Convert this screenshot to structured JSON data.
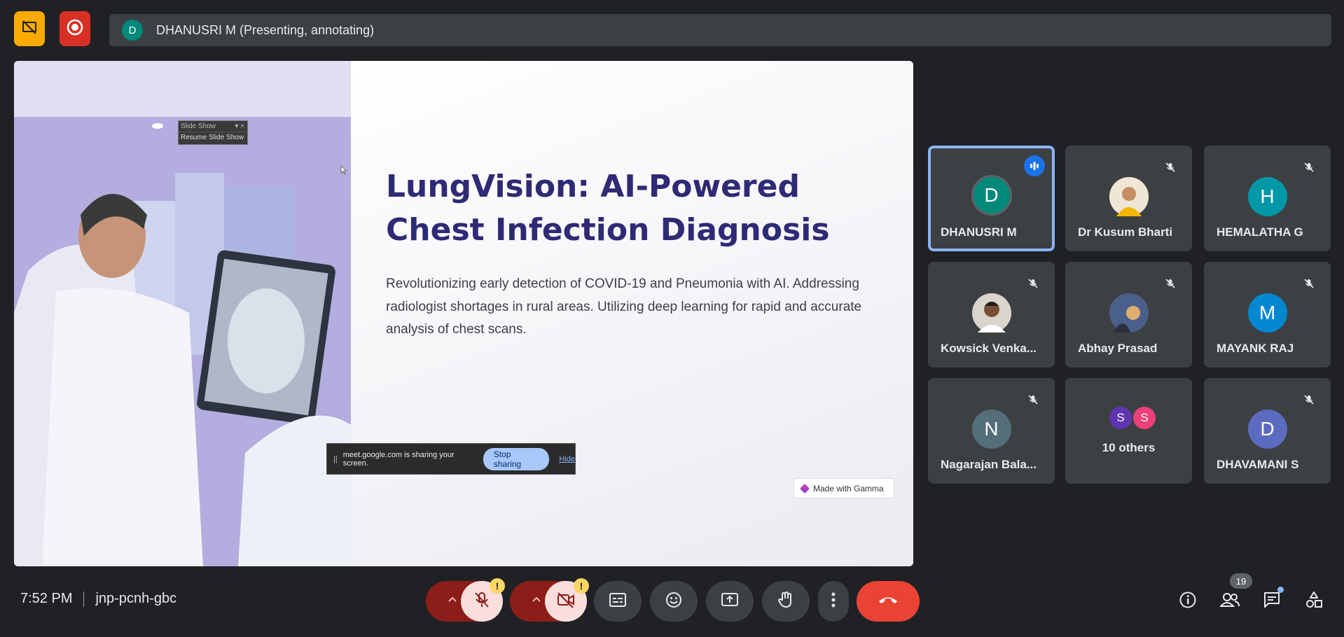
{
  "top": {
    "presenter_initial": "D",
    "presenter_label": "DHANUSRI M (Presenting, annotating)"
  },
  "slide": {
    "title": "LungVision: AI-Powered Chest Infection Diagnosis",
    "body": "Revolutionizing early detection of COVID-19 and Pneumonia with AI. Addressing radiologist shortages in rural areas. Utilizing deep learning for rapid and accurate analysis of chest scans.",
    "gamma_badge": "Made with Gamma",
    "slideshow_title": "Slide Show",
    "slideshow_resume": "Resume Slide Show"
  },
  "sharebar": {
    "message": "meet.google.com is sharing your screen.",
    "stop": "Stop sharing",
    "hide": "Hide"
  },
  "participants": [
    {
      "initial": "D",
      "name": "DHANUSRI M",
      "color": "#00897b",
      "speaking": true
    },
    {
      "initial": "",
      "name": "Dr Kusum Bharti",
      "color": "#f3e7c9",
      "photo": true
    },
    {
      "initial": "H",
      "name": "HEMALATHA G",
      "color": "#0097a7"
    },
    {
      "initial": "",
      "name": "Kowsick Venka...",
      "color": "#8a7f74",
      "photo": true
    },
    {
      "initial": "",
      "name": "Abhay Prasad",
      "color": "#3d4a6b",
      "photo": true
    },
    {
      "initial": "M",
      "name": "MAYANK RAJ",
      "color": "#0288d1"
    },
    {
      "initial": "N",
      "name": "Nagarajan Bala...",
      "color": "#546e7a"
    },
    {
      "initial": "",
      "name": "10 others",
      "color": "#3c4043",
      "others": [
        "S",
        "S"
      ]
    },
    {
      "initial": "D",
      "name": "DHAVAMANI S",
      "color": "#5c6bc0"
    }
  ],
  "bottom": {
    "time": "7:52 PM",
    "meeting_code": "jnp-pcnh-gbc",
    "people_count": "19",
    "warn": "!"
  },
  "colors": {
    "accent": "#8ab4f8",
    "end_call": "#ea4335",
    "muted_bg": "#f9dedc",
    "dark_red": "#8c1d18"
  }
}
